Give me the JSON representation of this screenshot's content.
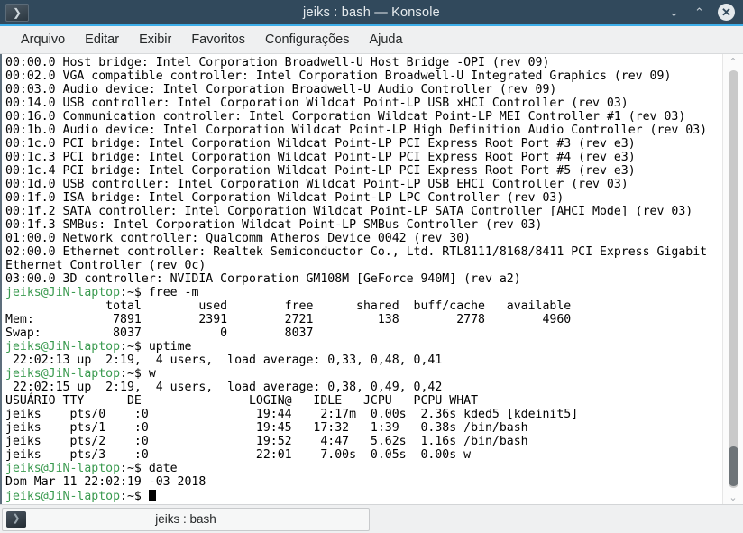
{
  "window": {
    "title": "jeiks : bash — Konsole",
    "app_icon": "terminal-icon",
    "minimize_label": "⌄",
    "maximize_label": "⌃",
    "close_label": "✕"
  },
  "menubar": {
    "items": [
      {
        "label": "Arquivo"
      },
      {
        "label": "Editar"
      },
      {
        "label": "Exibir"
      },
      {
        "label": "Favoritos"
      },
      {
        "label": "Configurações"
      },
      {
        "label": "Ajuda"
      }
    ]
  },
  "terminal": {
    "prompt": "jeiks@JiN-laptop",
    "prompt_suffix": ":~$ ",
    "lines": [
      {
        "type": "output",
        "text": "00:00.0 Host bridge: Intel Corporation Broadwell-U Host Bridge -OPI (rev 09)"
      },
      {
        "type": "output",
        "text": "00:02.0 VGA compatible controller: Intel Corporation Broadwell-U Integrated Graphics (rev 09)"
      },
      {
        "type": "output",
        "text": "00:03.0 Audio device: Intel Corporation Broadwell-U Audio Controller (rev 09)"
      },
      {
        "type": "output",
        "text": "00:14.0 USB controller: Intel Corporation Wildcat Point-LP USB xHCI Controller (rev 03)"
      },
      {
        "type": "output",
        "text": "00:16.0 Communication controller: Intel Corporation Wildcat Point-LP MEI Controller #1 (rev 03)"
      },
      {
        "type": "output",
        "text": "00:1b.0 Audio device: Intel Corporation Wildcat Point-LP High Definition Audio Controller (rev 03)"
      },
      {
        "type": "output",
        "text": "00:1c.0 PCI bridge: Intel Corporation Wildcat Point-LP PCI Express Root Port #3 (rev e3)"
      },
      {
        "type": "output",
        "text": "00:1c.3 PCI bridge: Intel Corporation Wildcat Point-LP PCI Express Root Port #4 (rev e3)"
      },
      {
        "type": "output",
        "text": "00:1c.4 PCI bridge: Intel Corporation Wildcat Point-LP PCI Express Root Port #5 (rev e3)"
      },
      {
        "type": "output",
        "text": "00:1d.0 USB controller: Intel Corporation Wildcat Point-LP USB EHCI Controller (rev 03)"
      },
      {
        "type": "output",
        "text": "00:1f.0 ISA bridge: Intel Corporation Wildcat Point-LP LPC Controller (rev 03)"
      },
      {
        "type": "output",
        "text": "00:1f.2 SATA controller: Intel Corporation Wildcat Point-LP SATA Controller [AHCI Mode] (rev 03)"
      },
      {
        "type": "output",
        "text": "00:1f.3 SMBus: Intel Corporation Wildcat Point-LP SMBus Controller (rev 03)"
      },
      {
        "type": "output",
        "text": "01:00.0 Network controller: Qualcomm Atheros Device 0042 (rev 30)"
      },
      {
        "type": "output",
        "text": "02:00.0 Ethernet controller: Realtek Semiconductor Co., Ltd. RTL8111/8168/8411 PCI Express Gigabit"
      },
      {
        "type": "output",
        "text": "Ethernet Controller (rev 0c)"
      },
      {
        "type": "output",
        "text": "03:00.0 3D controller: NVIDIA Corporation GM108M [GeForce 940M] (rev a2)"
      },
      {
        "type": "command",
        "text": "free -m"
      },
      {
        "type": "output",
        "text": "              total        used        free      shared  buff/cache   available"
      },
      {
        "type": "output",
        "text": "Mem:           7891        2391        2721         138        2778        4960"
      },
      {
        "type": "output",
        "text": "Swap:          8037           0        8037"
      },
      {
        "type": "command",
        "text": "uptime"
      },
      {
        "type": "output",
        "text": " 22:02:13 up  2:19,  4 users,  load average: 0,33, 0,48, 0,41"
      },
      {
        "type": "command",
        "text": "w"
      },
      {
        "type": "output",
        "text": " 22:02:15 up  2:19,  4 users,  load average: 0,38, 0,49, 0,42"
      },
      {
        "type": "output",
        "text": "USUÁRIO TTY      DE               LOGIN@   IDLE   JCPU   PCPU WHAT"
      },
      {
        "type": "output",
        "text": "jeiks    pts/0    :0               19:44    2:17m  0.00s  2.36s kded5 [kdeinit5]"
      },
      {
        "type": "output",
        "text": "jeiks    pts/1    :0               19:45   17:32   1:39   0.38s /bin/bash"
      },
      {
        "type": "output",
        "text": "jeiks    pts/2    :0               19:52    4:47   5.62s  1.16s /bin/bash"
      },
      {
        "type": "output",
        "text": "jeiks    pts/3    :0               22:01    7.00s  0.05s  0.00s w"
      },
      {
        "type": "command",
        "text": "date"
      },
      {
        "type": "output",
        "text": "Dom Mar 11 22:02:19 -03 2018"
      },
      {
        "type": "command",
        "text": "",
        "cursor": true
      }
    ]
  },
  "scrollbar": {
    "up_arrow": "⌃",
    "down_arrow": "⌄"
  },
  "tabbar": {
    "tabs": [
      {
        "label": "jeiks : bash",
        "icon": "terminal-icon"
      }
    ]
  },
  "colors": {
    "titlebar_bg": "#31495c",
    "accent": "#3daee9",
    "prompt_green": "#3a9a4f",
    "terminal_bg": "#ffffff",
    "terminal_fg": "#000000"
  }
}
